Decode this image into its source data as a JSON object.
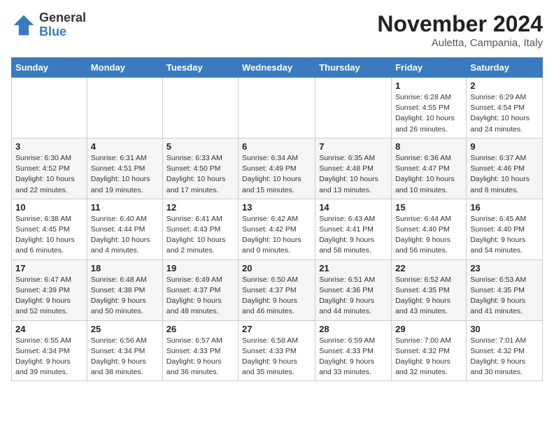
{
  "logo": {
    "general": "General",
    "blue": "Blue"
  },
  "header": {
    "title": "November 2024",
    "location": "Auletta, Campania, Italy"
  },
  "weekdays": [
    "Sunday",
    "Monday",
    "Tuesday",
    "Wednesday",
    "Thursday",
    "Friday",
    "Saturday"
  ],
  "weeks": [
    [
      {
        "day": "",
        "info": ""
      },
      {
        "day": "",
        "info": ""
      },
      {
        "day": "",
        "info": ""
      },
      {
        "day": "",
        "info": ""
      },
      {
        "day": "",
        "info": ""
      },
      {
        "day": "1",
        "info": "Sunrise: 6:28 AM\nSunset: 4:55 PM\nDaylight: 10 hours and 26 minutes."
      },
      {
        "day": "2",
        "info": "Sunrise: 6:29 AM\nSunset: 4:54 PM\nDaylight: 10 hours and 24 minutes."
      }
    ],
    [
      {
        "day": "3",
        "info": "Sunrise: 6:30 AM\nSunset: 4:52 PM\nDaylight: 10 hours and 22 minutes."
      },
      {
        "day": "4",
        "info": "Sunrise: 6:31 AM\nSunset: 4:51 PM\nDaylight: 10 hours and 19 minutes."
      },
      {
        "day": "5",
        "info": "Sunrise: 6:33 AM\nSunset: 4:50 PM\nDaylight: 10 hours and 17 minutes."
      },
      {
        "day": "6",
        "info": "Sunrise: 6:34 AM\nSunset: 4:49 PM\nDaylight: 10 hours and 15 minutes."
      },
      {
        "day": "7",
        "info": "Sunrise: 6:35 AM\nSunset: 4:48 PM\nDaylight: 10 hours and 13 minutes."
      },
      {
        "day": "8",
        "info": "Sunrise: 6:36 AM\nSunset: 4:47 PM\nDaylight: 10 hours and 10 minutes."
      },
      {
        "day": "9",
        "info": "Sunrise: 6:37 AM\nSunset: 4:46 PM\nDaylight: 10 hours and 8 minutes."
      }
    ],
    [
      {
        "day": "10",
        "info": "Sunrise: 6:38 AM\nSunset: 4:45 PM\nDaylight: 10 hours and 6 minutes."
      },
      {
        "day": "11",
        "info": "Sunrise: 6:40 AM\nSunset: 4:44 PM\nDaylight: 10 hours and 4 minutes."
      },
      {
        "day": "12",
        "info": "Sunrise: 6:41 AM\nSunset: 4:43 PM\nDaylight: 10 hours and 2 minutes."
      },
      {
        "day": "13",
        "info": "Sunrise: 6:42 AM\nSunset: 4:42 PM\nDaylight: 10 hours and 0 minutes."
      },
      {
        "day": "14",
        "info": "Sunrise: 6:43 AM\nSunset: 4:41 PM\nDaylight: 9 hours and 58 minutes."
      },
      {
        "day": "15",
        "info": "Sunrise: 6:44 AM\nSunset: 4:40 PM\nDaylight: 9 hours and 56 minutes."
      },
      {
        "day": "16",
        "info": "Sunrise: 6:45 AM\nSunset: 4:40 PM\nDaylight: 9 hours and 54 minutes."
      }
    ],
    [
      {
        "day": "17",
        "info": "Sunrise: 6:47 AM\nSunset: 4:39 PM\nDaylight: 9 hours and 52 minutes."
      },
      {
        "day": "18",
        "info": "Sunrise: 6:48 AM\nSunset: 4:38 PM\nDaylight: 9 hours and 50 minutes."
      },
      {
        "day": "19",
        "info": "Sunrise: 6:49 AM\nSunset: 4:37 PM\nDaylight: 9 hours and 48 minutes."
      },
      {
        "day": "20",
        "info": "Sunrise: 6:50 AM\nSunset: 4:37 PM\nDaylight: 9 hours and 46 minutes."
      },
      {
        "day": "21",
        "info": "Sunrise: 6:51 AM\nSunset: 4:36 PM\nDaylight: 9 hours and 44 minutes."
      },
      {
        "day": "22",
        "info": "Sunrise: 6:52 AM\nSunset: 4:35 PM\nDaylight: 9 hours and 43 minutes."
      },
      {
        "day": "23",
        "info": "Sunrise: 6:53 AM\nSunset: 4:35 PM\nDaylight: 9 hours and 41 minutes."
      }
    ],
    [
      {
        "day": "24",
        "info": "Sunrise: 6:55 AM\nSunset: 4:34 PM\nDaylight: 9 hours and 39 minutes."
      },
      {
        "day": "25",
        "info": "Sunrise: 6:56 AM\nSunset: 4:34 PM\nDaylight: 9 hours and 38 minutes."
      },
      {
        "day": "26",
        "info": "Sunrise: 6:57 AM\nSunset: 4:33 PM\nDaylight: 9 hours and 36 minutes."
      },
      {
        "day": "27",
        "info": "Sunrise: 6:58 AM\nSunset: 4:33 PM\nDaylight: 9 hours and 35 minutes."
      },
      {
        "day": "28",
        "info": "Sunrise: 6:59 AM\nSunset: 4:33 PM\nDaylight: 9 hours and 33 minutes."
      },
      {
        "day": "29",
        "info": "Sunrise: 7:00 AM\nSunset: 4:32 PM\nDaylight: 9 hours and 32 minutes."
      },
      {
        "day": "30",
        "info": "Sunrise: 7:01 AM\nSunset: 4:32 PM\nDaylight: 9 hours and 30 minutes."
      }
    ]
  ]
}
